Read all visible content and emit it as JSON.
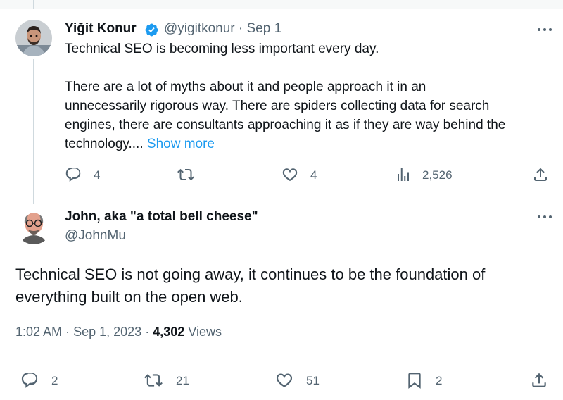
{
  "parent_tweet": {
    "author_name": "Yiğit Konur",
    "handle": "@yigitkonur",
    "separator": "·",
    "date": "Sep 1",
    "text_lines": [
      "Technical SEO is becoming less important every day.",
      "",
      "There are a lot of myths about it and people approach it in an",
      "unnecessarily rigorous way. There are spiders collecting data for search",
      "engines, there are consultants approaching it as if they are way behind the"
    ],
    "last_line_text": "technology.... ",
    "show_more_label": "Show more",
    "replies": "4",
    "likes": "4",
    "views": "2,526"
  },
  "main_tweet": {
    "author_name": "John, aka \"a total bell cheese\"",
    "handle": "@JohnMu",
    "text_lines": [
      "Technical SEO is not going away, it continues to be the foundation of",
      "everything built on the open web."
    ],
    "time": "1:02 AM",
    "sep1": "·",
    "date": "Sep 1, 2023",
    "sep2": "·",
    "views_count": "4,302",
    "views_label": "Views",
    "replies": "2",
    "retweets": "21",
    "likes": "51",
    "bookmarks": "2"
  },
  "icons": {
    "verified": "verified-badge-icon",
    "reply": "reply-icon",
    "retweet": "retweet-icon",
    "like": "heart-icon",
    "views": "views-chart-icon",
    "share": "share-icon",
    "bookmark": "bookmark-icon",
    "more": "more-icon"
  },
  "colors": {
    "text": "#0f1419",
    "muted": "#536471",
    "link": "#1d9bf0",
    "verified": "#1d9bf0"
  }
}
